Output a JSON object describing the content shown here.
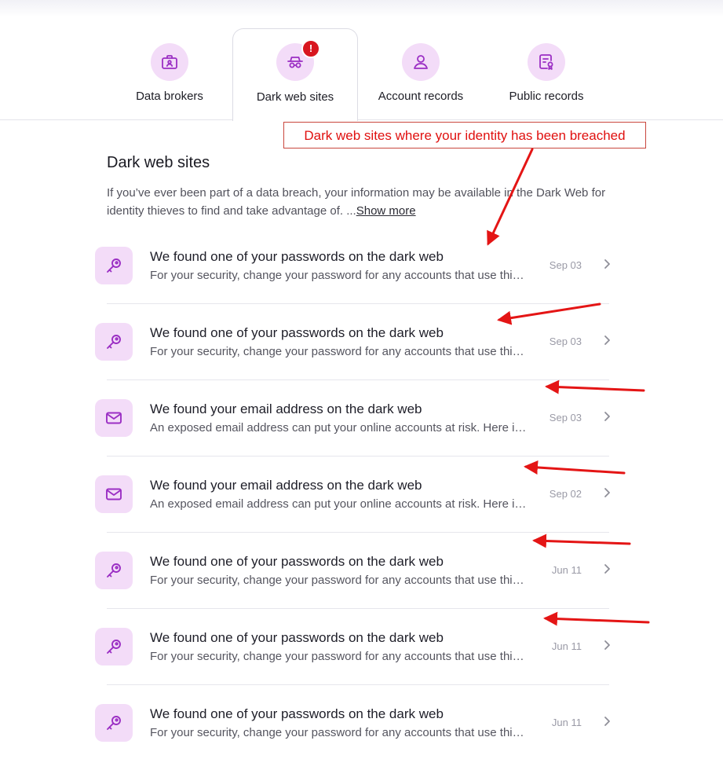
{
  "tabs": [
    {
      "label": "Data brokers",
      "icon": "briefcase-icon",
      "active": false
    },
    {
      "label": "Dark web sites",
      "icon": "spy-hat-icon",
      "active": true,
      "badge": "!"
    },
    {
      "label": "Account records",
      "icon": "person-icon",
      "active": false
    },
    {
      "label": "Public records",
      "icon": "certificate-icon",
      "active": false
    }
  ],
  "annotation": "Dark web sites where your identity has been breached",
  "section": {
    "title": "Dark web sites",
    "description": "If you’ve ever been part of a data breach, your information may be available in the Dark Web for identity thieves to find and take advantage of. ...",
    "show_more": "Show more"
  },
  "rows": [
    {
      "type": "key",
      "title": "We found one of your passwords on the dark web",
      "subtitle": "For your security, change your password for any accounts that use this password.",
      "date": "Sep 03"
    },
    {
      "type": "key",
      "title": "We found one of your passwords on the dark web",
      "subtitle": "For your security, change your password for any accounts that use this password.",
      "date": "Sep 03"
    },
    {
      "type": "mail",
      "title": "We found your email address on the dark web",
      "subtitle": "An exposed email address can put your online accounts at risk. Here is what you can do.",
      "date": "Sep 03"
    },
    {
      "type": "mail",
      "title": "We found your email address on the dark web",
      "subtitle": "An exposed email address can put your online accounts at risk. Here is what you can do.",
      "date": "Sep 02"
    },
    {
      "type": "key",
      "title": "We found one of your passwords on the dark web",
      "subtitle": "For your security, change your password for any accounts that use this password.",
      "date": "Jun 11"
    },
    {
      "type": "key",
      "title": "We found one of your passwords on the dark web",
      "subtitle": "For your security, change your password for any accounts that use this password.",
      "date": "Jun 11"
    },
    {
      "type": "key",
      "title": "We found one of your passwords on the dark web",
      "subtitle": "For your security, change your password for any accounts that use this password.",
      "date": "Jun 11"
    }
  ],
  "colors": {
    "accent": "#9b2fc4",
    "icon_bg": "#f3dcf8",
    "badge": "#d8161f",
    "annotation": "#e0100f"
  }
}
